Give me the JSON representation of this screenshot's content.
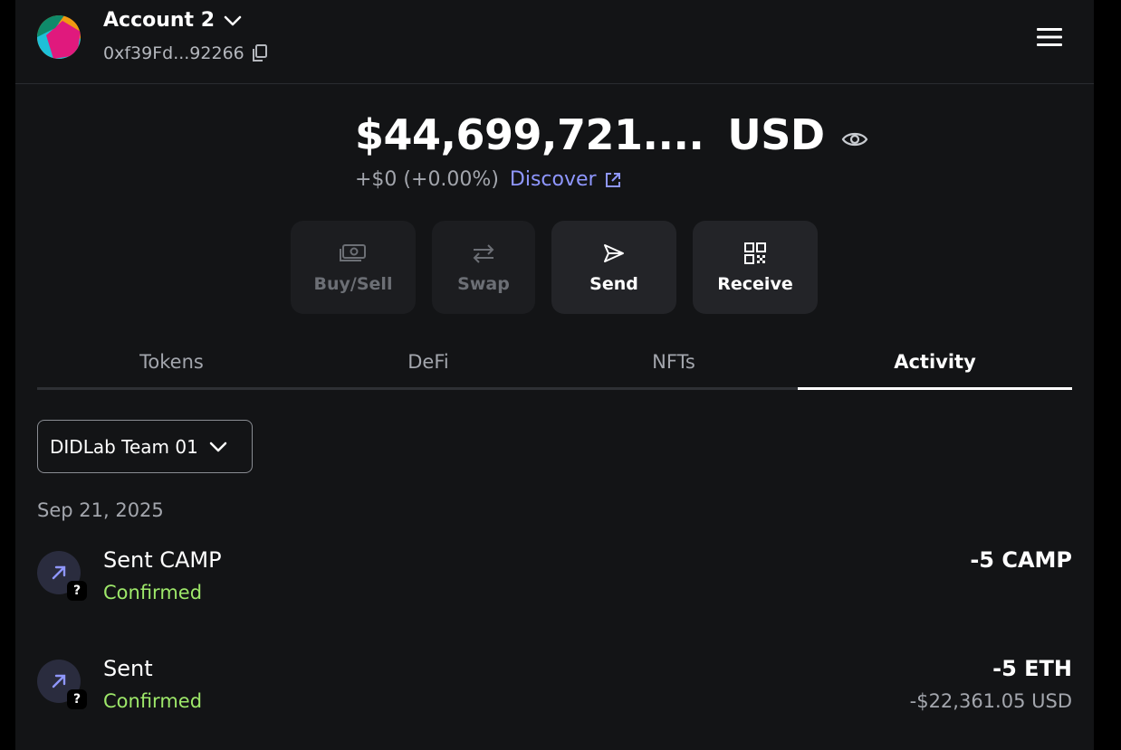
{
  "header": {
    "account_name": "Account 2",
    "account_address": "0xf39Fd...92266"
  },
  "balance": {
    "amount": "$44,699,721....",
    "currency": "USD",
    "change": "+$0 (+0.00%)",
    "discover_label": "Discover"
  },
  "actions": [
    {
      "label": "Buy/Sell",
      "icon": "money-icon",
      "enabled": false
    },
    {
      "label": "Swap",
      "icon": "swap-arrows-icon",
      "enabled": false
    },
    {
      "label": "Send",
      "icon": "send-icon",
      "enabled": true
    },
    {
      "label": "Receive",
      "icon": "qr-code-icon",
      "enabled": true
    }
  ],
  "tabs": [
    {
      "label": "Tokens",
      "active": false
    },
    {
      "label": "DeFi",
      "active": false
    },
    {
      "label": "NFTs",
      "active": false
    },
    {
      "label": "Activity",
      "active": true
    }
  ],
  "network_selector": {
    "value": "DIDLab Team 01"
  },
  "activity": {
    "date": "Sep 21, 2025",
    "items": [
      {
        "title": "Sent CAMP",
        "status": "Confirmed",
        "amount": "-5 CAMP",
        "fiat": ""
      },
      {
        "title": "Sent",
        "status": "Confirmed",
        "amount": "-5 ETH",
        "fiat": "-$22,361.05 USD"
      }
    ]
  },
  "colors": {
    "background": "#131416",
    "accent_link": "#8f97ff",
    "status_confirmed": "#9ee86a",
    "muted_text": "#a3a6ad"
  }
}
